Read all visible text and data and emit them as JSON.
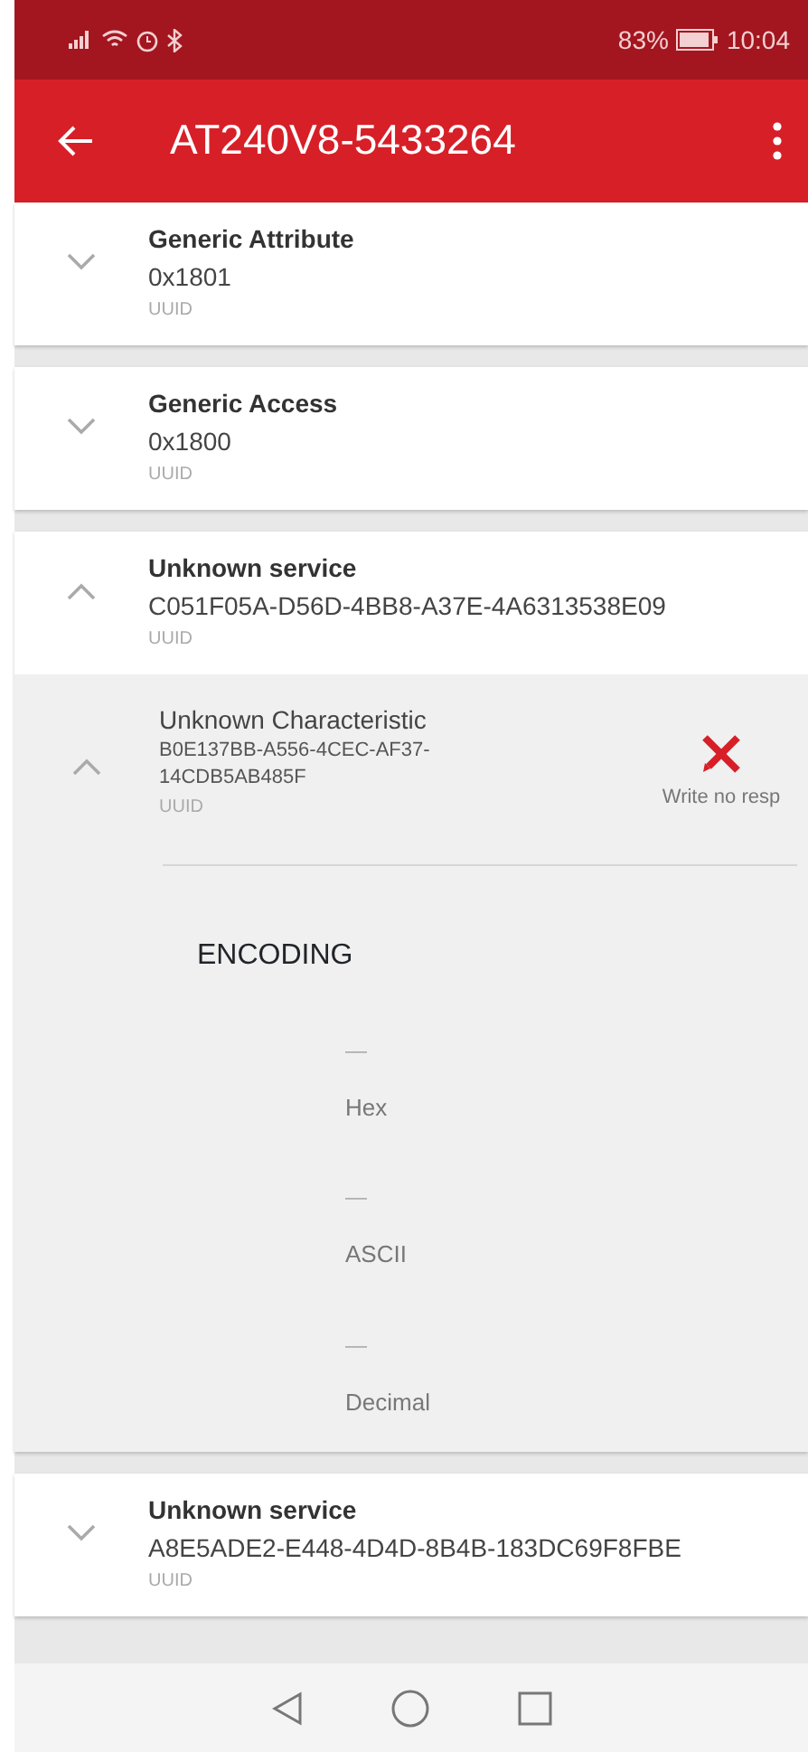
{
  "status_bar": {
    "battery": "83%",
    "time": "10:04"
  },
  "app_bar": {
    "title": "AT240V8-5433264"
  },
  "services": [
    {
      "name": "Generic Attribute",
      "uuid": "0x1801",
      "uuid_label": "UUID",
      "expanded": false
    },
    {
      "name": "Generic Access",
      "uuid": "0x1800",
      "uuid_label": "UUID",
      "expanded": false
    },
    {
      "name": "Unknown service",
      "uuid": "C051F05A-D56D-4BB8-A37E-4A6313538E09",
      "uuid_label": "UUID",
      "expanded": true,
      "characteristics": [
        {
          "name": "Unknown Characteristic",
          "uuid": "B0E137BB-A556-4CEC-AF37-14CDB5AB485F",
          "uuid_label": "UUID",
          "expanded": true,
          "property": "Write no resp",
          "encoding": {
            "title": "ENCODING",
            "options": [
              {
                "value": "—",
                "label": "Hex"
              },
              {
                "value": "—",
                "label": "ASCII"
              },
              {
                "value": "—",
                "label": "Decimal"
              }
            ]
          }
        }
      ]
    },
    {
      "name": "Unknown service",
      "uuid": "A8E5ADE2-E448-4D4D-8B4B-183DC69F8FBE",
      "uuid_label": "UUID",
      "expanded": false
    }
  ]
}
